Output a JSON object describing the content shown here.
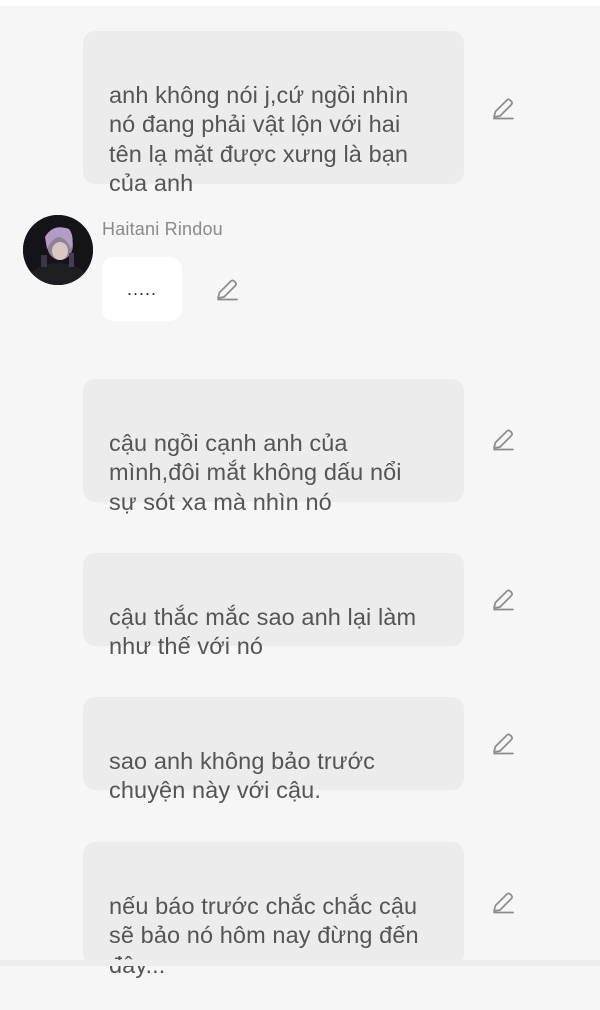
{
  "messages": [
    {
      "text": "anh không nói j,cứ ngồi nhìn\nnó đang phải vật lộn với hai\ntên lạ mặt được xưng là bạn\ncủa anh"
    },
    {
      "text": "cậu ngồi cạnh anh của\nmình,đôi mắt không dấu nổi\nsự sót xa mà nhìn nó"
    },
    {
      "text": "cậu thắc mắc sao anh lại làm\nnhư thế với nó"
    },
    {
      "text": "sao anh không bảo trước\nchuyện này với cậu."
    },
    {
      "text": "nếu báo trước chắc chắc cậu\nsẽ bảo nó hôm nay đừng đến\nđây..."
    }
  ],
  "character": {
    "name": "Haitani Rindou",
    "reply": "....."
  },
  "icons": {
    "edit": "pencil-edit-icon",
    "avatar": "character-avatar"
  },
  "colors": {
    "background": "#f6f6f6",
    "user_bubble": "#ececec",
    "character_bubble": "#ffffff",
    "text": "#555555",
    "name": "#8a8a8a"
  }
}
